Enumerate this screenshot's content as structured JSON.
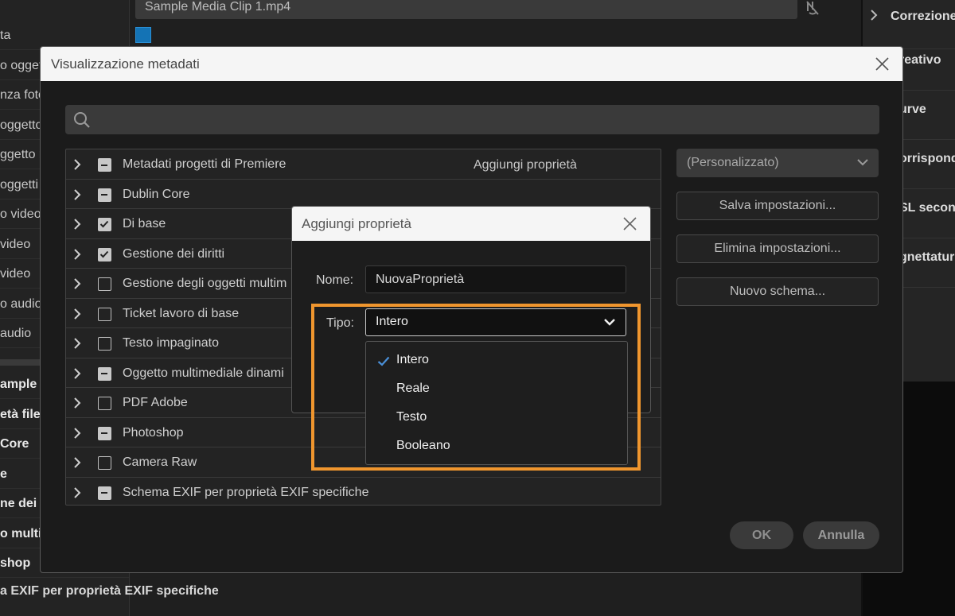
{
  "background": {
    "clip_field": "Sample Media Clip 1.mp4",
    "left_rows": [
      "ta",
      "o oggetti",
      "nza foto",
      "oggetto",
      "ggetto m",
      "oggetti",
      "o video",
      "video",
      "video",
      "o audio",
      "audio",
      "ample M",
      "età file",
      " Core",
      "e",
      "ne dei d",
      "o multi",
      "shop"
    ],
    "bottom_text": "a EXIF per proprietà EXIF specifiche",
    "right_rows": [
      "Correzione",
      "reativo",
      "urve",
      "orrispond",
      "SL secon",
      "gnettatur"
    ]
  },
  "dialog": {
    "title": "Visualizzazione metadati",
    "search": {
      "placeholder": "",
      "value": ""
    },
    "add_property_link": "Aggiungi proprietà",
    "schemas": [
      {
        "label": "Metadati progetti di Premiere",
        "state": "mixed"
      },
      {
        "label": "Dublin Core",
        "state": "mixed"
      },
      {
        "label": "Di base",
        "state": "checked"
      },
      {
        "label": "Gestione dei diritti",
        "state": "checked"
      },
      {
        "label": "Gestione degli oggetti multim",
        "state": "unchecked"
      },
      {
        "label": "Ticket lavoro di base",
        "state": "unchecked"
      },
      {
        "label": "Testo impaginato",
        "state": "unchecked"
      },
      {
        "label": "Oggetto multimediale dinami",
        "state": "mixed"
      },
      {
        "label": "PDF Adobe",
        "state": "unchecked"
      },
      {
        "label": "Photoshop",
        "state": "mixed"
      },
      {
        "label": "Camera Raw",
        "state": "unchecked"
      },
      {
        "label": "Schema EXIF per proprietà EXIF specifiche",
        "state": "mixed"
      }
    ],
    "preset": "(Personalizzato)",
    "buttons": {
      "save": "Salva impostazioni...",
      "delete": "Elimina impostazioni...",
      "new_schema": "Nuovo schema...",
      "ok": "OK",
      "cancel": "Annulla"
    }
  },
  "add_property_dialog": {
    "title": "Aggiungi proprietà",
    "name_label": "Nome:",
    "name_value": "NuovaProprietà",
    "type_label": "Tipo:",
    "type_value": "Intero",
    "type_options": [
      "Intero",
      "Reale",
      "Testo",
      "Booleano"
    ],
    "selected_option": "Intero"
  },
  "colors": {
    "highlight": "#f0962e",
    "check": "#4a90d9",
    "title_bar": "#f5f5f5"
  }
}
